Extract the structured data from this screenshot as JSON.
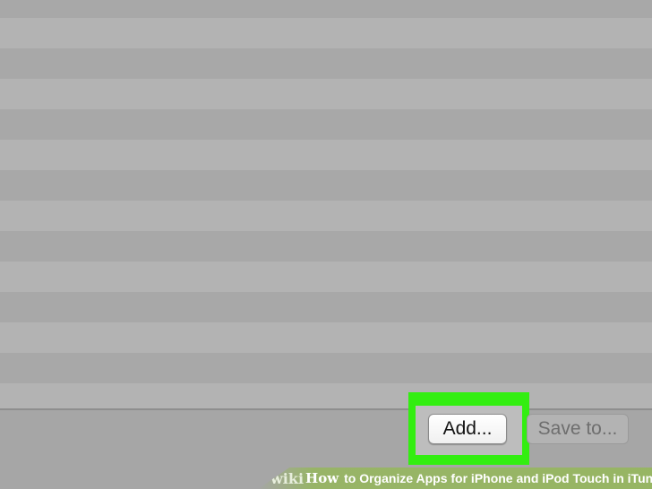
{
  "bottom_bar": {
    "add_label": "Add...",
    "save_label": "Save to..."
  },
  "banner": {
    "brand": "wiki",
    "brand_how": "How",
    "title": "to Organize Apps for iPhone and iPod Touch in iTunes"
  },
  "colors": {
    "highlight": "#33ee11",
    "row_light": "#b3b3b3",
    "row_dark": "#a8a8a8",
    "banner_green": "#95b75c"
  }
}
